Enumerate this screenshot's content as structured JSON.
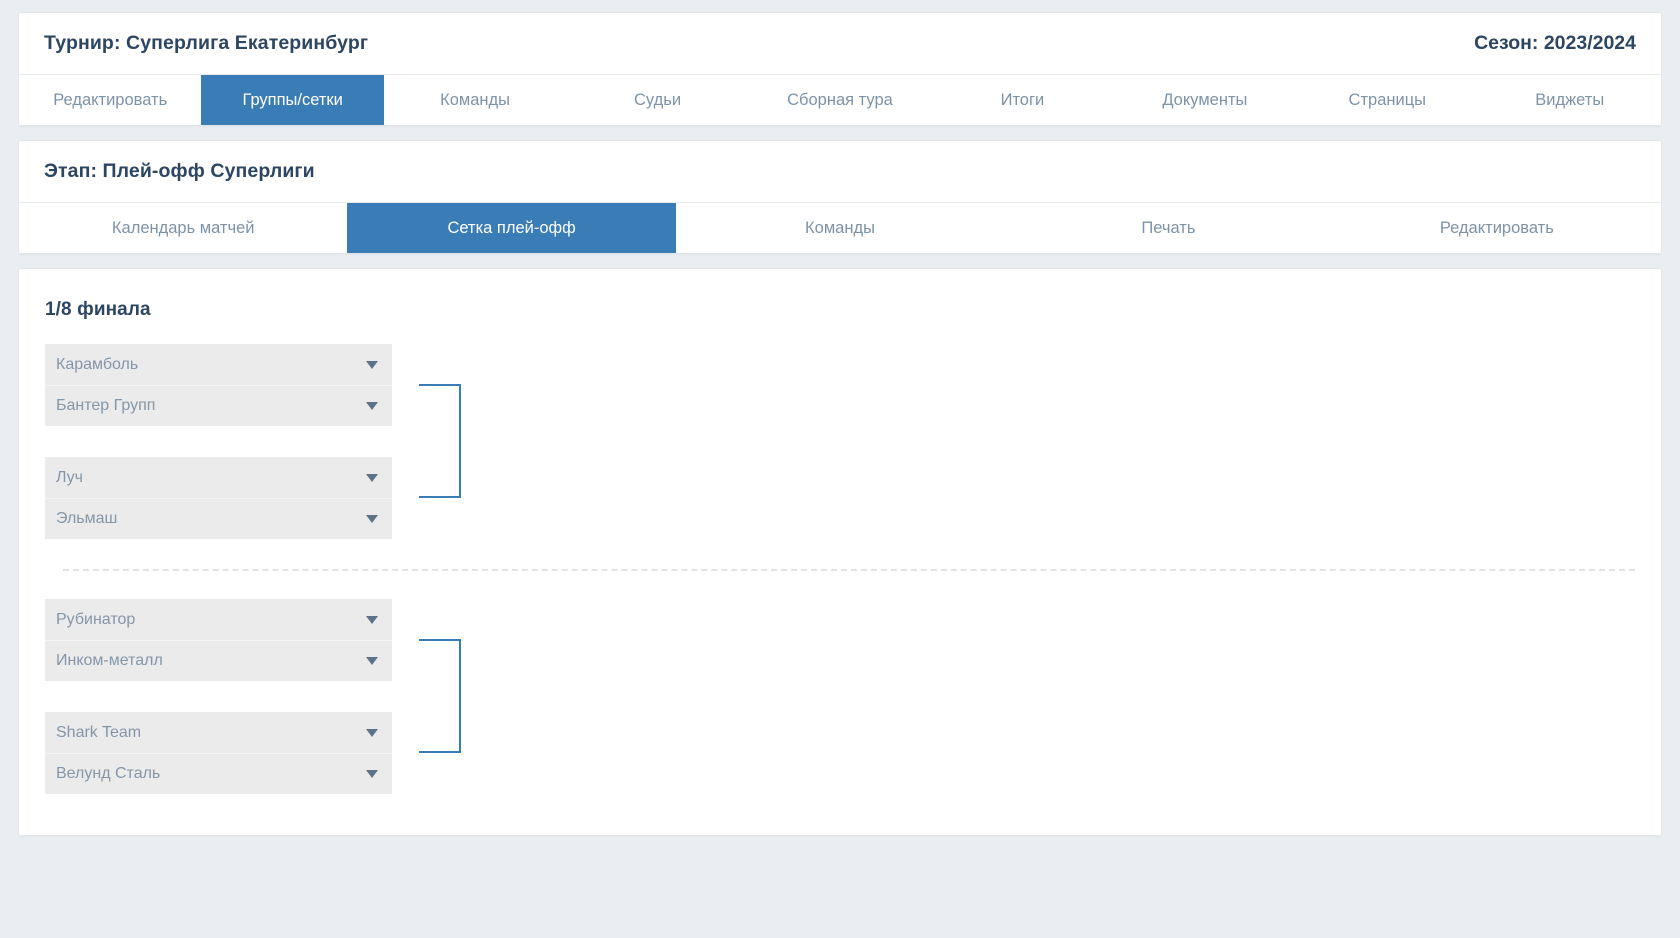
{
  "header": {
    "tournament_title": "Турнир: Суперлига Екатеринбург",
    "season": "Сезон: 2023/2024",
    "tabs": [
      {
        "label": "Редактировать",
        "active": false
      },
      {
        "label": "Группы/сетки",
        "active": true
      },
      {
        "label": "Команды",
        "active": false
      },
      {
        "label": "Судьи",
        "active": false
      },
      {
        "label": "Сборная тура",
        "active": false
      },
      {
        "label": "Итоги",
        "active": false
      },
      {
        "label": "Документы",
        "active": false
      },
      {
        "label": "Страницы",
        "active": false
      },
      {
        "label": "Виджеты",
        "active": false
      }
    ]
  },
  "stage": {
    "title": "Этап: Плей-офф Суперлиги",
    "tabs": [
      {
        "label": "Календарь матчей",
        "active": false
      },
      {
        "label": "Сетка плей-офф",
        "active": true
      },
      {
        "label": "Команды",
        "active": false
      },
      {
        "label": "Печать",
        "active": false
      },
      {
        "label": "Редактировать",
        "active": false
      }
    ]
  },
  "bracket": {
    "round_title": "1/8 финала",
    "groups": [
      {
        "pairs": [
          {
            "slots": [
              {
                "team": "Карамболь"
              },
              {
                "team": "Бантер Групп"
              }
            ]
          },
          {
            "slots": [
              {
                "team": "Луч"
              },
              {
                "team": "Эльмаш"
              }
            ]
          }
        ]
      },
      {
        "pairs": [
          {
            "slots": [
              {
                "team": "Рубинатор"
              },
              {
                "team": "Инком-металл"
              }
            ]
          },
          {
            "slots": [
              {
                "team": "Shark Team"
              },
              {
                "team": "Велунд Сталь"
              }
            ]
          }
        ]
      }
    ]
  },
  "colors": {
    "accent": "#3a7cb5",
    "page_background": "#eaeef3",
    "card_background": "#ffffff",
    "slot_background": "#ebebeb",
    "heading_text": "#2d4661",
    "muted_text": "#7d93a8"
  },
  "icons": {
    "caret": "chevron-down-icon"
  }
}
